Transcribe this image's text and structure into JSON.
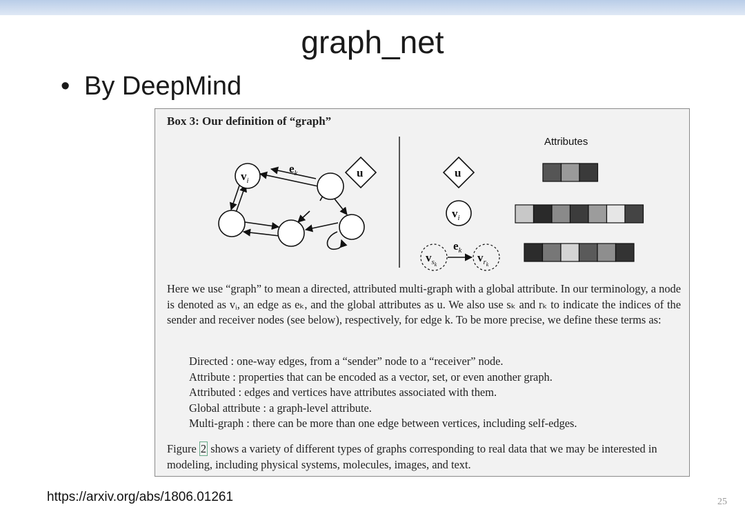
{
  "slide": {
    "title": "graph_net",
    "bullet": "By DeepMind",
    "source_url": "https://arxiv.org/abs/1806.01261",
    "page_number": "25"
  },
  "box": {
    "title": "Box 3: Our definition of “graph”",
    "attributes_label": "Attributes",
    "paragraph1": "Here we use “graph” to mean a directed, attributed multi-graph with a global attribute. In our terminology, a node is denoted as vᵢ, an edge as eₖ, and the global attributes as u. We also use sₖ and rₖ to indicate the indices of the sender and receiver nodes (see below), respectively, for edge k. To be more precise, we define these terms as:",
    "definitions": [
      "Directed : one-way edges, from a “sender” node to a “receiver” node.",
      "Attribute : properties that can be encoded as a vector, set, or even another graph.",
      "Attributed : edges and vertices have attributes associated with them.",
      "Global attribute : a graph-level attribute.",
      "Multi-graph : there can be more than one edge between vertices, including self-edges."
    ],
    "paragraph2_before": "Figure ",
    "paragraph2_ref": "2",
    "paragraph2_after": " shows a variety of different types of graphs corresponding to real data that we may be interested in modeling, including physical systems, molecules, images, and text."
  },
  "diagram": {
    "node_label": "v",
    "node_sub": "i",
    "edge_label": "e",
    "edge_sub": "k",
    "global_label": "u",
    "sender_label": "v",
    "sender_sub": "s",
    "receiver_label": "v",
    "receiver_sub": "r",
    "sub_k": "k",
    "colors": {
      "u_attr": [
        "#555555",
        "#9a9a9a",
        "#3a3a3a"
      ],
      "v_attr": [
        "#c8c8c8",
        "#2a2a2a",
        "#8a8a8a",
        "#3c3c3c",
        "#9c9c9c",
        "#e6e6e6",
        "#444444"
      ],
      "e_attr": [
        "#2c2c2c",
        "#777777",
        "#d4d4d4",
        "#5a5a5a",
        "#8e8e8e",
        "#333333"
      ]
    }
  }
}
